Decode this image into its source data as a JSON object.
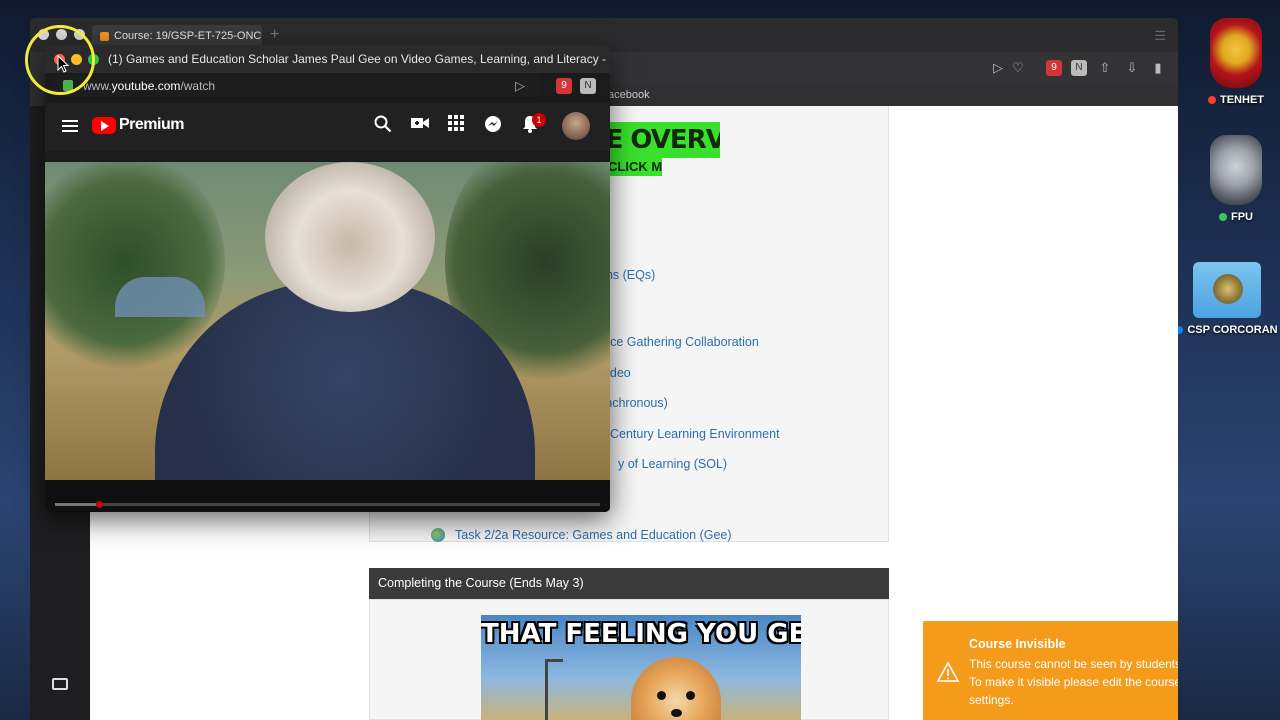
{
  "desktop": {
    "icons": [
      {
        "label": "TENHET",
        "status_color": "#ff3b30"
      },
      {
        "label": "FPU",
        "status_color": "#34c759"
      },
      {
        "label": "CSP CORCORAN",
        "status_color": "#0a84ff"
      }
    ]
  },
  "browser": {
    "tab_title": "Course: 19/GSP-ET-725-ONC",
    "new_tab": "+",
    "bookmark_item": "acebook",
    "extension_badge": "9"
  },
  "course": {
    "banner_line1": "LE OVERVIEW",
    "banner_line2": "CLICK ME",
    "section_heading": "S",
    "links": [
      "ons (EQs)",
      "urce Gathering Collaboration",
      "Video",
      "ynchronous)",
      "Century Learning Environment",
      "y of Learning (SOL)",
      "Task 2/2a Resource: Games and Education (Gee)"
    ],
    "section_title": "Completing the Course (Ends May 3)",
    "meme_text": "THAT FEELING YOU GET"
  },
  "toast": {
    "title": "Course Invisible",
    "body": "This course cannot be seen by students. To make it visible please edit the course settings.",
    "color": "#f59b1b"
  },
  "pip": {
    "window_title": "(1) Games and Education Scholar James Paul Gee on Video Games, Learning, and Literacy -",
    "address_prefix": "www.",
    "address_domain": "youtube.com",
    "address_path": "/watch",
    "youtube": {
      "brand": "Premium",
      "notification_count": "1",
      "progress": 0.08
    }
  }
}
